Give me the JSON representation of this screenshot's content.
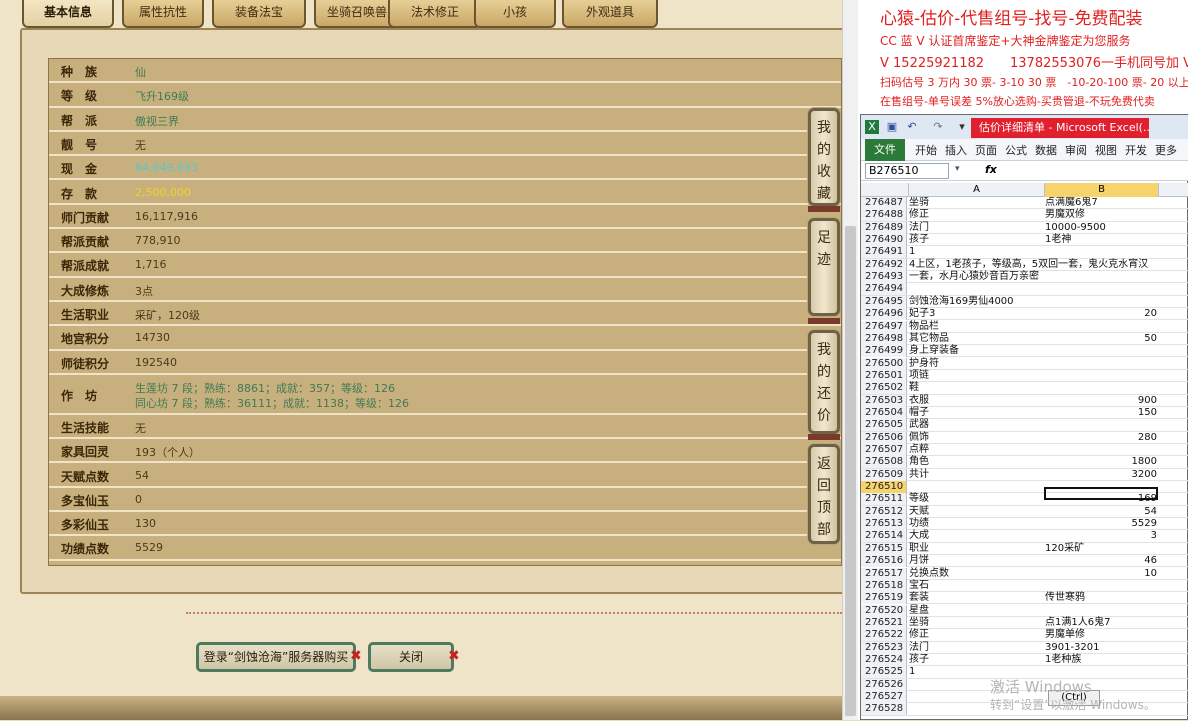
{
  "tabs": [
    "基本信息",
    "属性抗性",
    "装备法宝",
    "坐骑召唤兽",
    "法术修正",
    "小孩",
    "外观道具"
  ],
  "rows": [
    {
      "label": "种　族",
      "value": "仙",
      "style": "green"
    },
    {
      "label": "等　级",
      "value": "飞升169级",
      "style": "green"
    },
    {
      "label": "帮　派",
      "value": "傲视三界",
      "style": "green"
    },
    {
      "label": "靓　号",
      "value": "无",
      "style": ""
    },
    {
      "label": "现　金",
      "value": "64,649,683",
      "style": "cyan"
    },
    {
      "label": "存　款",
      "value": "2,500,000",
      "style": "yellow"
    },
    {
      "label": "师门贡献",
      "value": "16,117,916",
      "style": ""
    },
    {
      "label": "帮派贡献",
      "value": "778,910",
      "style": ""
    },
    {
      "label": "帮派成就",
      "value": "1,716",
      "style": ""
    },
    {
      "label": "大成修炼",
      "value": "3点",
      "style": ""
    },
    {
      "label": "生活职业",
      "value": "采矿，120级",
      "style": ""
    },
    {
      "label": "地宫积分",
      "value": "14730",
      "style": ""
    },
    {
      "label": "师徒积分",
      "value": "192540",
      "style": ""
    },
    {
      "label": "作　坊",
      "value": "生莲坊 7 段；熟练：8861；成就：357；等级：126",
      "value2": "同心坊 7 段；熟练：36111；成就：1138；等级：126",
      "style": "green"
    },
    {
      "label": "生活技能",
      "value": "无",
      "style": ""
    },
    {
      "label": "家具回灵",
      "value": "193（个人）",
      "style": ""
    },
    {
      "label": "天赋点数",
      "value": "54",
      "style": ""
    },
    {
      "label": "多宝仙玉",
      "value": "0",
      "style": ""
    },
    {
      "label": "多彩仙玉",
      "value": "130",
      "style": ""
    },
    {
      "label": "功绩点数",
      "value": "5529",
      "style": ""
    }
  ],
  "side_buttons": [
    "我的收藏",
    "足迹",
    "我的还价",
    "返回顶部"
  ],
  "buttons": {
    "buy": "登录“剑蚀沧海”服务器购买",
    "close": "关闭"
  },
  "banner": {
    "title": "心猿-估价-代售组号-找号-免费配装",
    "line1": "CC 蓝 V 认证首席鉴定+大神金牌鉴定为您服务",
    "line2": "V 15225921182　　13782553076一手机同号加 V",
    "line3": "扫码估号 3 万内 30 票- 3-10 30 票　-10-20-100 票- 20 以上 150",
    "line4": "在售组号-单号误差 5%放心选购-买贵管退-不玩免费代卖"
  },
  "excel": {
    "title": "估价详细清单 - Microsoft Excel(...",
    "ribbon": [
      "开始",
      "插入",
      "页面",
      "公式",
      "数据",
      "审阅",
      "视图",
      "开发",
      "更多"
    ],
    "file_tab": "文件",
    "namebox": "B276510",
    "fx": "fx",
    "col_a": "A",
    "col_b": "B",
    "sheet_rows": [
      {
        "n": "276487",
        "a": "坐骑",
        "b": "点满魔6鬼7"
      },
      {
        "n": "276488",
        "a": "修正",
        "b": "男魔双修"
      },
      {
        "n": "276489",
        "a": "法门",
        "b": "10000-9500"
      },
      {
        "n": "276490",
        "a": "孩子",
        "b": "1老神"
      },
      {
        "n": "276491",
        "a": "                         1",
        "b": ""
      },
      {
        "n": "276492",
        "a": "4上区，1老孩子，等级高，5双回一套，鬼火克水宵汉",
        "b": ""
      },
      {
        "n": "276493",
        "a": "一套，水月心猿妙音百万亲密",
        "b": ""
      },
      {
        "n": "276494",
        "a": "",
        "b": ""
      },
      {
        "n": "276495",
        "a": "剑蚀沧海169男仙4000",
        "b": ""
      },
      {
        "n": "276496",
        "a": "妃子3",
        "b": "20"
      },
      {
        "n": "276497",
        "a": "物品栏",
        "b": ""
      },
      {
        "n": "276498",
        "a": "其它物品",
        "b": "50"
      },
      {
        "n": "276499",
        "a": "身上穿装备",
        "b": ""
      },
      {
        "n": "276500",
        "a": "护身符",
        "b": ""
      },
      {
        "n": "276501",
        "a": "项链",
        "b": ""
      },
      {
        "n": "276502",
        "a": "鞋",
        "b": ""
      },
      {
        "n": "276503",
        "a": "衣服",
        "b": "900"
      },
      {
        "n": "276504",
        "a": "帽子",
        "b": "150"
      },
      {
        "n": "276505",
        "a": "武器",
        "b": ""
      },
      {
        "n": "276506",
        "a": "佩饰",
        "b": "280"
      },
      {
        "n": "276507",
        "a": "点粹",
        "b": ""
      },
      {
        "n": "276508",
        "a": "角色",
        "b": "1800"
      },
      {
        "n": "276509",
        "a": "共计",
        "b": "3200"
      },
      {
        "n": "276510",
        "a": "",
        "b": ""
      },
      {
        "n": "276511",
        "a": "等级",
        "b": "169"
      },
      {
        "n": "276512",
        "a": "天赋",
        "b": "54"
      },
      {
        "n": "276513",
        "a": "功绩",
        "b": "5529"
      },
      {
        "n": "276514",
        "a": "大成",
        "b": "3"
      },
      {
        "n": "276515",
        "a": "职业",
        "b": "120采矿"
      },
      {
        "n": "276516",
        "a": "月饼",
        "b": "46"
      },
      {
        "n": "276517",
        "a": "兑换点数",
        "b": "10"
      },
      {
        "n": "276518",
        "a": "宝石",
        "b": ""
      },
      {
        "n": "276519",
        "a": "套装",
        "b": "传世寒鸦"
      },
      {
        "n": "276520",
        "a": "星盘",
        "b": ""
      },
      {
        "n": "276521",
        "a": "坐骑",
        "b": "点1满1人6鬼7"
      },
      {
        "n": "276522",
        "a": "修正",
        "b": "男魔单修"
      },
      {
        "n": "276523",
        "a": "法门",
        "b": "3901-3201"
      },
      {
        "n": "276524",
        "a": "孩子",
        "b": "1老种族"
      },
      {
        "n": "276525",
        "a": "                         1",
        "b": ""
      },
      {
        "n": "276526",
        "a": "",
        "b": ""
      },
      {
        "n": "276527",
        "a": "",
        "b": ""
      },
      {
        "n": "276528",
        "a": "",
        "b": ""
      }
    ],
    "selected_row": "276510",
    "ctrl_label": "(Ctrl)"
  },
  "watermark": {
    "line1": "激活 Windows",
    "line2": "转到“设置”以激活 Windows。"
  }
}
